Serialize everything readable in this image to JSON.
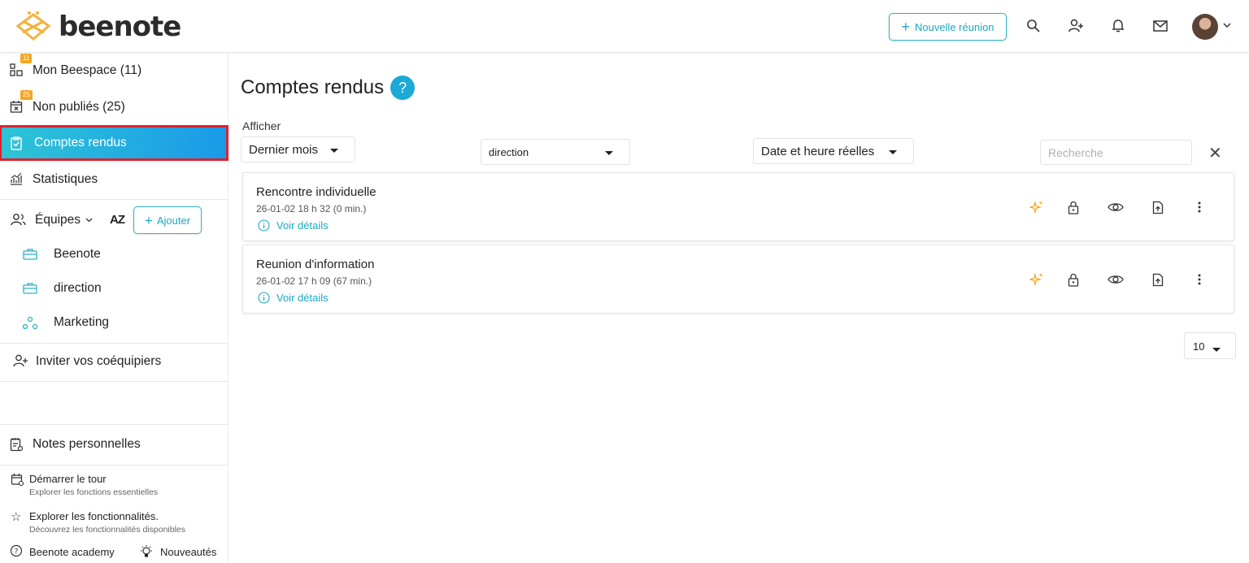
{
  "header": {
    "logo_text": "beenote",
    "new_meeting_label": "Nouvelle réunion",
    "icons": [
      "search-icon",
      "add-user-icon",
      "bell-icon",
      "mail-icon",
      "avatar",
      "chevron-down-icon"
    ]
  },
  "sidebar": {
    "items": [
      {
        "label": "Mon Beespace",
        "count": "(11)",
        "badge": "11",
        "icon": "dashboard-icon"
      },
      {
        "label": "Non publiés",
        "count": "(25)",
        "badge": "25",
        "icon": "calendar-x-icon"
      },
      {
        "label": "Comptes rendus",
        "icon": "clipboard-check-icon",
        "active": true
      },
      {
        "label": "Statistiques",
        "icon": "chart-icon"
      }
    ],
    "teams_label": "Équipes",
    "sort_label": "AZ",
    "add_label": "Ajouter",
    "teams": [
      {
        "label": "Beenote",
        "icon": "briefcase-icon"
      },
      {
        "label": "direction",
        "icon": "briefcase-icon"
      },
      {
        "label": "Marketing",
        "icon": "nodes-icon"
      }
    ],
    "invite_label": "Inviter vos coéquipiers",
    "notes_label": "Notes personnelles",
    "tour_title": "Démarrer le tour",
    "tour_sub": "Explorer les fonctions essentielles",
    "explore_title": "Explorer les fonctionnalités.",
    "explore_sub": "Découvrez les fonctionnalités disponibles",
    "academy_label": "Beenote academy",
    "news_label": "Nouveautés"
  },
  "main": {
    "title": "Comptes rendus",
    "help": "?",
    "afficher_label": "Afficher",
    "filters": {
      "period": "Dernier mois",
      "team": "direction",
      "date_mode": "Date et heure réelles",
      "search_placeholder": "Recherche"
    },
    "meetings": [
      {
        "title": "Rencontre individuelle",
        "date": "26-01-02 18 h 32 (0 min.)",
        "details": "Voir détails"
      },
      {
        "title": "Reunion d'information",
        "date": "26-01-02 17 h 09 (67 min.)",
        "details": "Voir détails"
      }
    ],
    "per_page": "10"
  },
  "colors": {
    "accent": "#1ba9c4",
    "active_gradient_start": "#2ec4d6",
    "active_gradient_end": "#1a9ae8",
    "badge": "#f5a623",
    "highlight_border": "#e0212d",
    "ai_icon": "#f5a623"
  }
}
